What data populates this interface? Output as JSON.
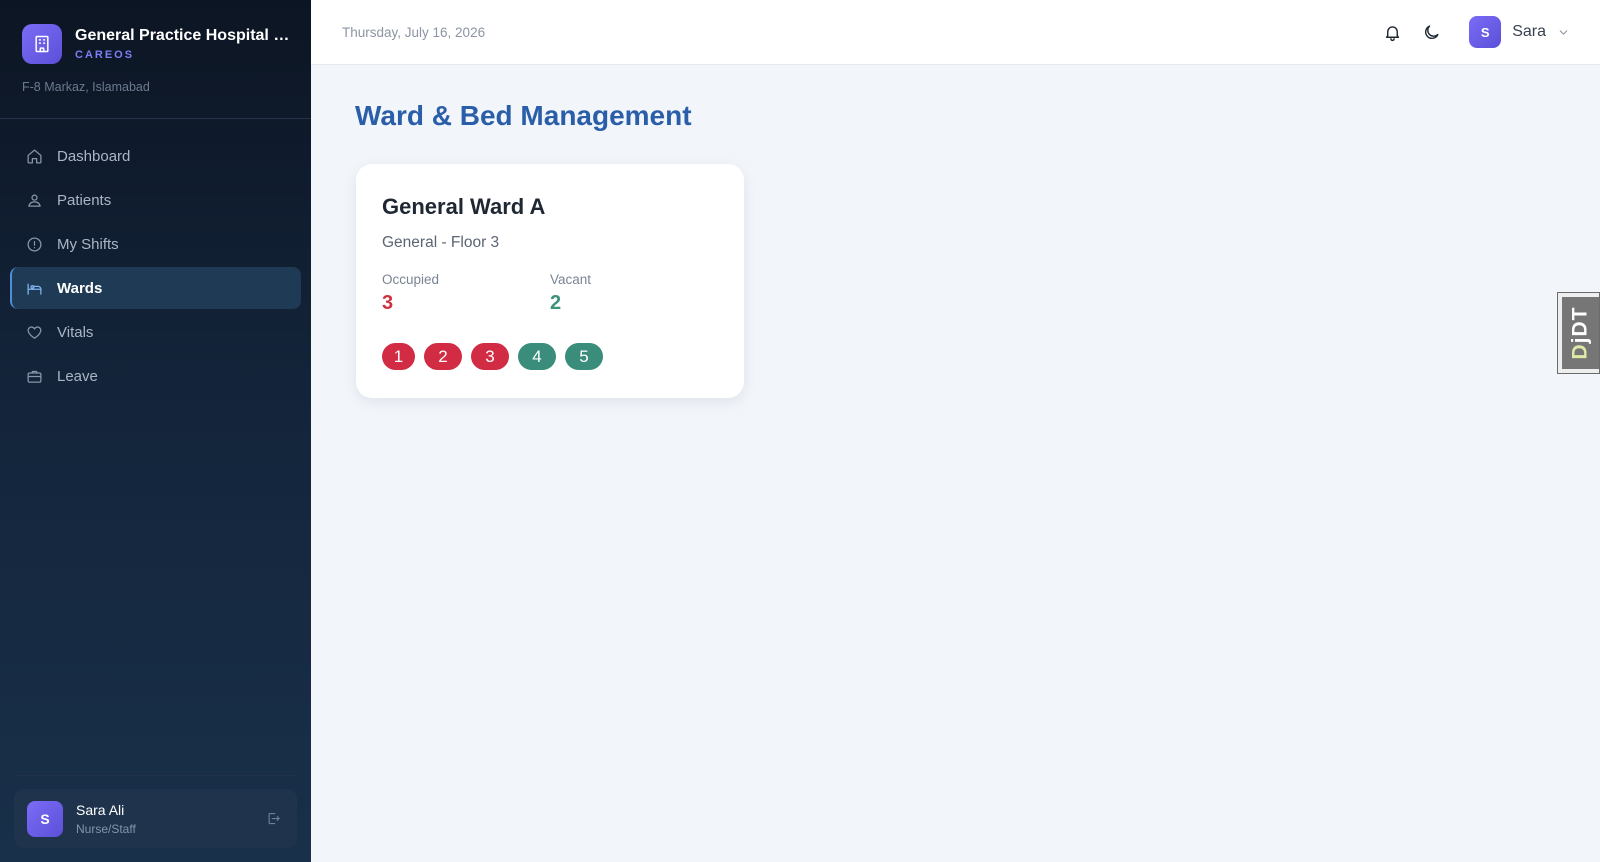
{
  "sidebar": {
    "brand_name": "General Practice Hospital I...",
    "brand_sub": "CAREOS",
    "location": "F-8 Markaz, Islamabad",
    "nav": [
      {
        "label": "Dashboard",
        "icon": "home-icon",
        "active": false
      },
      {
        "label": "Patients",
        "icon": "patients-icon",
        "active": false
      },
      {
        "label": "My Shifts",
        "icon": "info-icon",
        "active": false
      },
      {
        "label": "Wards",
        "icon": "bed-icon",
        "active": true
      },
      {
        "label": "Vitals",
        "icon": "heart-icon",
        "active": false
      },
      {
        "label": "Leave",
        "icon": "briefcase-icon",
        "active": false
      }
    ],
    "user": {
      "initial": "S",
      "name": "Sara Ali",
      "role": "Nurse/Staff"
    }
  },
  "topbar": {
    "date": "Thursday, July 16, 2026",
    "profile_initial": "S",
    "profile_name": "Sara"
  },
  "main": {
    "title": "Ward & Bed Management",
    "ward": {
      "name": "General Ward A",
      "type": "General - Floor 3",
      "occupied_label": "Occupied",
      "occupied_count": "3",
      "vacant_label": "Vacant",
      "vacant_count": "2",
      "beds": [
        {
          "number": "1",
          "status": "occupied"
        },
        {
          "number": "2",
          "status": "occupied"
        },
        {
          "number": "3",
          "status": "occupied"
        },
        {
          "number": "4",
          "status": "vacant"
        },
        {
          "number": "5",
          "status": "vacant"
        }
      ]
    }
  },
  "debug_toolbar": {
    "label_d": "D",
    "label_rest": "jDT"
  },
  "colors": {
    "accent": "#6b5ff0",
    "title": "#2a5ea8",
    "occupied": "#d12c43",
    "vacant": "#3a8c7b",
    "sidebar_bg": "#13243a"
  }
}
